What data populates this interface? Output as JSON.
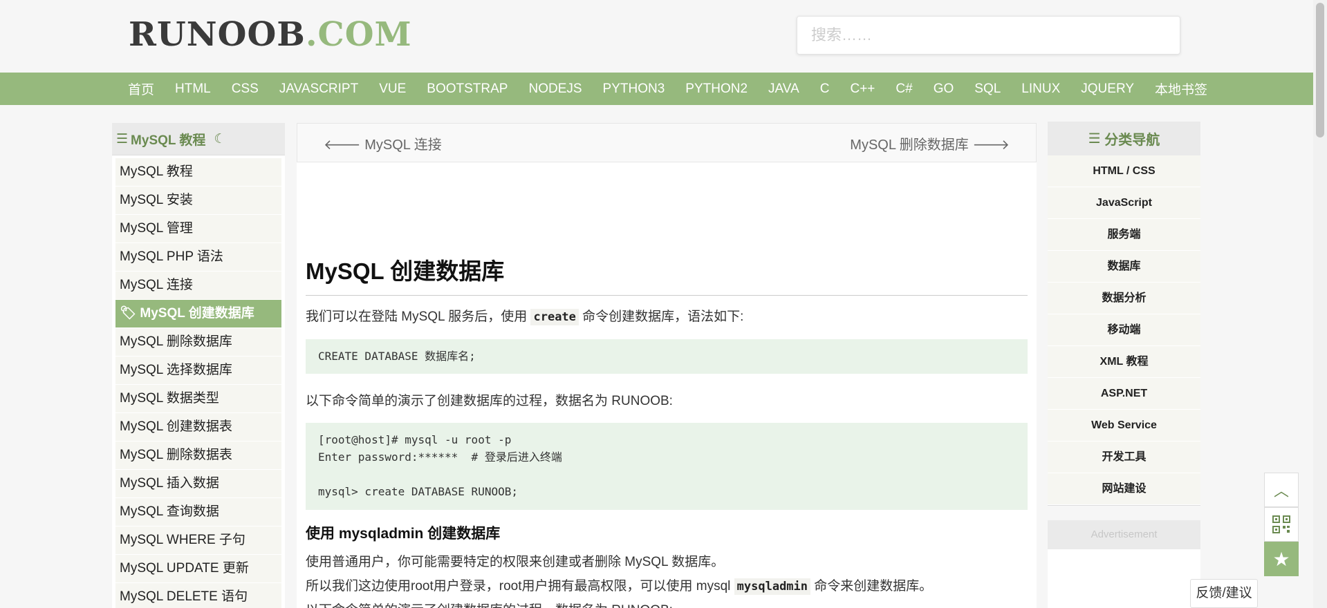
{
  "header": {
    "logo_main": "RUNOOB",
    "logo_suffix": ".COM",
    "search_placeholder": "搜索……"
  },
  "topnav": [
    "首页",
    "HTML",
    "CSS",
    "JAVASCRIPT",
    "VUE",
    "BOOTSTRAP",
    "NODEJS",
    "PYTHON3",
    "PYTHON2",
    "JAVA",
    "C",
    "C++",
    "C#",
    "GO",
    "SQL",
    "LINUX",
    "JQUERY",
    "本地书签"
  ],
  "leftbar": {
    "title": "MySQL 教程",
    "title_icon": "list-icon",
    "theme_icon": "moon-icon",
    "items": [
      "MySQL 教程",
      "MySQL 安装",
      "MySQL 管理",
      "MySQL PHP 语法",
      "MySQL 连接",
      "MySQL 创建数据库",
      "MySQL 删除数据库",
      "MySQL 选择数据库",
      "MySQL 数据类型",
      "MySQL 创建数据表",
      "MySQL 删除数据表",
      "MySQL 插入数据",
      "MySQL 查询数据",
      "MySQL WHERE 子句",
      "MySQL UPDATE 更新",
      "MySQL DELETE 语句"
    ],
    "active_index": 5,
    "active_icon": "tag-icon"
  },
  "pager": {
    "prev": "MySQL 连接",
    "next": "MySQL 删除数据库"
  },
  "article": {
    "title": "MySQL 创建数据库",
    "p1_pre": "我们可以在登陆 MySQL 服务后，使用 ",
    "p1_code": "create",
    "p1_post": " 命令创建数据库，语法如下:",
    "code1": [
      "CREATE DATABASE 数据库名;"
    ],
    "p2": "以下命令简单的演示了创建数据库的过程，数据名为 RUNOOB:",
    "code2": [
      "[root@host]# mysql -u root -p",
      "Enter password:******  # 登录后进入终端",
      "",
      "mysql> create DATABASE RUNOOB;"
    ],
    "h2": "使用 mysqladmin 创建数据库",
    "p3": "使用普通用户，你可能需要特定的权限来创建或者删除 MySQL 数据库。",
    "p4_pre": "所以我们这边使用root用户登录，root用户拥有最高权限，可以使用 mysql ",
    "p4_code": "mysqladmin",
    "p4_post": " 命令来创建数据库。",
    "p5": "以下命令简单的演示了创建数据库的过程，数据名为 RUNOOB:"
  },
  "rightbar": {
    "title": "分类导航",
    "items": [
      "HTML / CSS",
      "JavaScript",
      "服务端",
      "数据库",
      "数据分析",
      "移动端",
      "XML 教程",
      "ASP.NET",
      "Web Service",
      "开发工具",
      "网站建设"
    ]
  },
  "ad_label": "Advertisement",
  "feedback": "反馈/建议",
  "colors": {
    "brand_green": "#96b97d",
    "code_bg": "#e9f3e9"
  }
}
